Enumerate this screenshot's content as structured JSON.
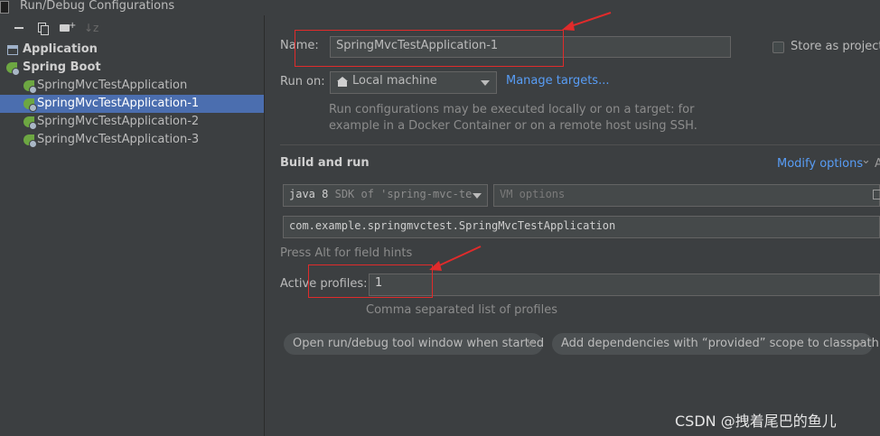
{
  "window": {
    "title": "Run/Debug Configurations"
  },
  "sidebar": {
    "toolbar": {
      "remove_icon": "minus-icon",
      "copy_icon": "copy-icon",
      "folder_icon": "new-folder-icon",
      "sort_icon": "sort-icon",
      "sort_glyph": "↓z"
    },
    "tree": [
      {
        "label": "Application",
        "icon": "application-icon",
        "bold": true
      },
      {
        "label": "Spring Boot",
        "icon": "spring-boot-icon",
        "bold": true
      },
      {
        "label": "SpringMvcTestApplication",
        "icon": "spring-boot-icon"
      },
      {
        "label": "SpringMvcTestApplication-1",
        "icon": "spring-boot-icon",
        "selected": true
      },
      {
        "label": "SpringMvcTestApplication-2",
        "icon": "spring-boot-icon"
      },
      {
        "label": "SpringMvcTestApplication-3",
        "icon": "spring-boot-icon"
      }
    ]
  },
  "form": {
    "name_label": "Name:",
    "name_value": "SpringMvcTestApplication-1",
    "store_label": "Store as project f",
    "run_on_label": "Run on:",
    "run_on_value": "Local machine",
    "manage_targets": "Manage targets...",
    "run_hint_line1": "Run configurations may be executed locally or on a target: for",
    "run_hint_line2": "example in a Docker Container or on a remote host using SSH.",
    "section_title": "Build and run",
    "modify_options": "Modify options",
    "modify_chevron": "⌄",
    "modify_shortcut": "A",
    "jdk_name": "java 8",
    "jdk_detail": "SDK of 'spring-mvc-te",
    "vm_placeholder": "VM options",
    "main_class": "com.example.springmvctest.SpringMvcTestApplication",
    "field_hint": "Press Alt for field hints",
    "profiles_label": "Active profiles:",
    "profiles_value": "1",
    "profiles_hint": "Comma separated list of profiles",
    "chips": [
      {
        "label": "Open run/debug tool window when started"
      },
      {
        "label": "Add dependencies with “provided” scope to classpath"
      }
    ],
    "chip_close_glyph": "×"
  },
  "annotations": {
    "arrow_color": "#e02b2b"
  },
  "watermark": "CSDN @拽着尾巴的鱼儿",
  "colors": {
    "background": "#3c3f41",
    "selection": "#4b6eaf",
    "link": "#589df6",
    "spring_green": "#6da742"
  }
}
